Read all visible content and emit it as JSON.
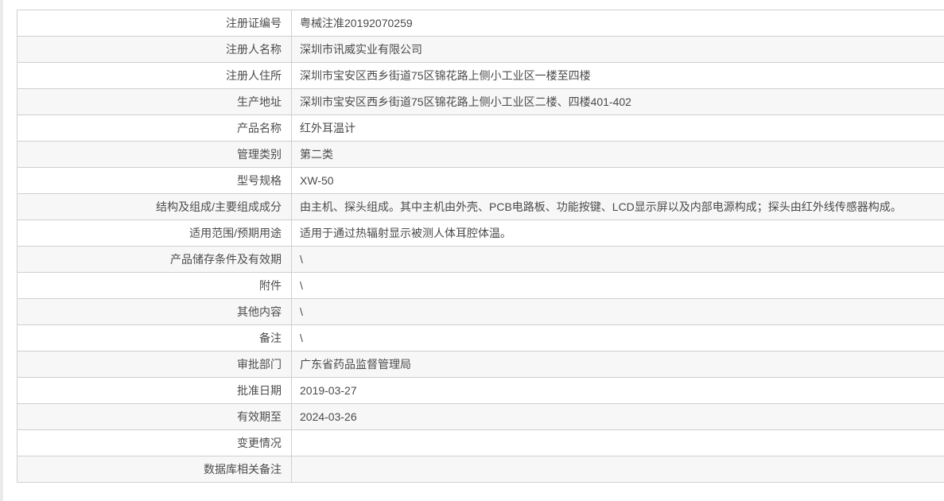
{
  "page": {
    "background_color": "#ffffff",
    "left_strip_color": "#eaeaea",
    "border_color": "#cfcfcf",
    "stripe_color": "#f7f7f7",
    "text_color": "#4a4a4a"
  },
  "table": {
    "rows": [
      {
        "label": "注册证编号",
        "value": "粤械注准20192070259"
      },
      {
        "label": "注册人名称",
        "value": "深圳市讯威实业有限公司"
      },
      {
        "label": "注册人住所",
        "value": "深圳市宝安区西乡街道75区锦花路上侧小工业区一楼至四楼"
      },
      {
        "label": "生产地址",
        "value": "深圳市宝安区西乡街道75区锦花路上侧小工业区二楼、四楼401-402"
      },
      {
        "label": "产品名称",
        "value": "红外耳温计"
      },
      {
        "label": "管理类别",
        "value": "第二类"
      },
      {
        "label": "型号规格",
        "value": "XW-50"
      },
      {
        "label": "结构及组成/主要组成成分",
        "value": "由主机、探头组成。其中主机由外壳、PCB电路板、功能按键、LCD显示屏以及内部电源构成；探头由红外线传感器构成。"
      },
      {
        "label": "适用范围/预期用途",
        "value": "适用于通过热辐射显示被测人体耳腔体温。"
      },
      {
        "label": "产品储存条件及有效期",
        "value": "\\"
      },
      {
        "label": "附件",
        "value": "\\"
      },
      {
        "label": "其他内容",
        "value": "\\"
      },
      {
        "label": "备注",
        "value": "\\"
      },
      {
        "label": "审批部门",
        "value": "广东省药品监督管理局"
      },
      {
        "label": "批准日期",
        "value": "2019-03-27"
      },
      {
        "label": "有效期至",
        "value": "2024-03-26"
      },
      {
        "label": "变更情况",
        "value": ""
      },
      {
        "label": "数据库相关备注",
        "value": ""
      }
    ]
  }
}
